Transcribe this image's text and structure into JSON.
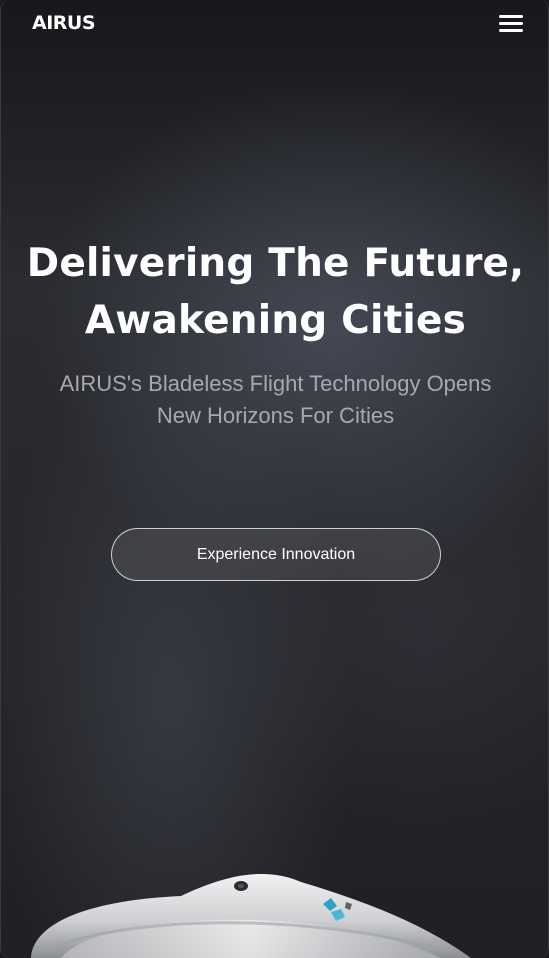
{
  "header": {
    "logo_text": "AIRUS",
    "menu_icon": "hamburger-menu-icon"
  },
  "hero": {
    "title_line1": "Delivering The Future,",
    "title_line2": "Awakening Cities",
    "subtitle_line1": "AIRUS's Bladeless Flight Technology Opens",
    "subtitle_line2": "New Horizons For Cities",
    "cta_label": "Experience Innovation"
  },
  "colors": {
    "background": "#1b1c20",
    "text_primary": "#ffffff",
    "text_secondary": "#a7a9ad",
    "drone_body": "#d9dadc",
    "drone_accent": "#2aa3c4"
  },
  "images": {
    "drone": "bladeless-drone-image"
  }
}
